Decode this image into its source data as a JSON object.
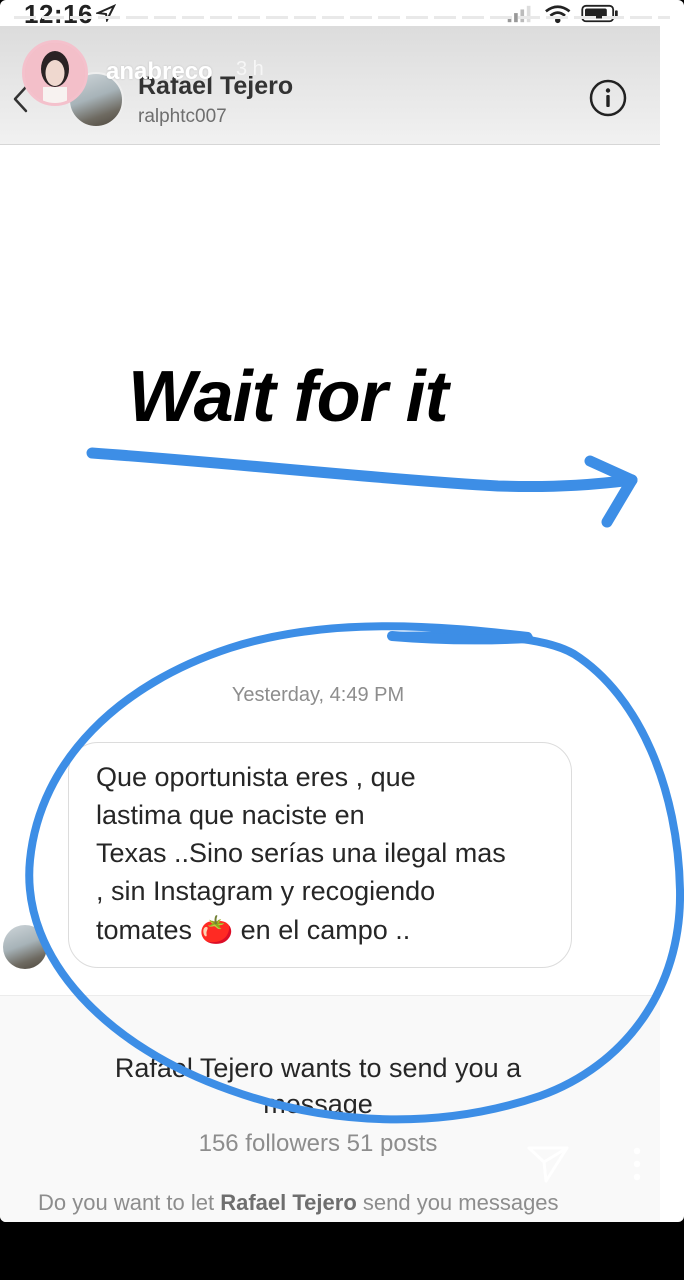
{
  "status_bar": {
    "time": "12:16"
  },
  "story": {
    "owner_name": "anabreco",
    "owner_time": "3 h",
    "text": "Wait for it"
  },
  "dm": {
    "name": "Rafael Tejero",
    "handle": "ralphtc007",
    "timestamp": "Yesterday, 4:49 PM",
    "message_lines": [
      "Que oportunista eres , que",
      "lastima que naciste en",
      "Texas ..Sino serías una ilegal mas",
      ", sin Instagram y recogiendo",
      "tomates 🍅 en el campo .."
    ],
    "request_title": "Rafael Tejero wants to send you a message",
    "request_stats": "156 followers 51 posts",
    "request_question_prefix": "Do you want to let ",
    "request_question_name": "Rafael Tejero",
    "request_question_suffix": " send you messages"
  },
  "colors": {
    "annotation_blue": "#3d8ee6",
    "owner_avatar_pink": "#f2b9c3"
  }
}
